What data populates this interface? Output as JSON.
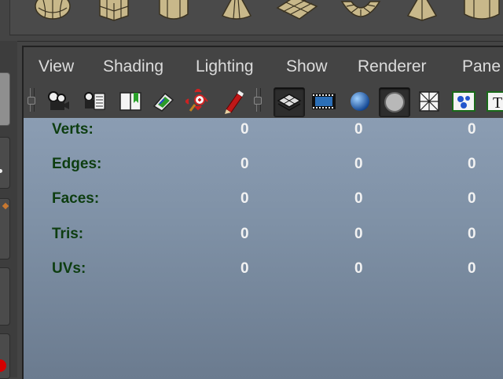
{
  "menu": {
    "items": [
      "View",
      "Shading",
      "Lighting",
      "Show",
      "Renderer",
      "Pane"
    ]
  },
  "shelf": {
    "icons": [
      "sphere-icon",
      "cube-icon",
      "cylinder-icon",
      "cone-icon",
      "plane-icon",
      "torus-icon",
      "pyramid-icon",
      "pipe-icon"
    ]
  },
  "toolbar": {
    "icons": [
      "select-camera-icon",
      "camera-attributes-icon",
      "bookmarks-icon",
      "image-plane-icon",
      "camera-tools-icon",
      "grease-pencil-icon",
      "wireframe-icon",
      "film-gate-icon",
      "smooth-shade-icon",
      "shaded-icon",
      "xray-icon",
      "isolate-icon",
      "text-icon"
    ]
  },
  "hud": {
    "rows": [
      {
        "label": "Verts:",
        "values": [
          "0",
          "0",
          "0"
        ]
      },
      {
        "label": "Edges:",
        "values": [
          "0",
          "0",
          "0"
        ]
      },
      {
        "label": "Faces:",
        "values": [
          "0",
          "0",
          "0"
        ]
      },
      {
        "label": "Tris:",
        "values": [
          "0",
          "0",
          "0"
        ]
      },
      {
        "label": "UVs:",
        "values": [
          "0",
          "0",
          "0"
        ]
      }
    ]
  },
  "colors": {
    "viewport_top": "#8b9db3",
    "viewport_bottom": "#6b7b8f",
    "hud_label": "#0d3d10",
    "hud_value": "#f2f2f2"
  }
}
